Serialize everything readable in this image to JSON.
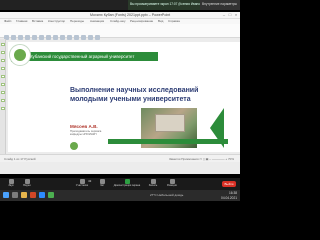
{
  "notifications": {
    "left_text": "",
    "mid_text": "Вы просматриваете экран 17:07 (Ксения Иванова)",
    "right_text": "Внутренние параметры"
  },
  "window": {
    "title": "Мохилх Кубан (Fonts) 2021ppt.pptx – PowerPoint",
    "menu": [
      "Файл",
      "Главная",
      "Вставка",
      "Конструктор",
      "Переходы",
      "Анимация",
      "Слайд-шоу",
      "Рецензирование",
      "Вид",
      "Справка"
    ],
    "minimize": "–",
    "maximize": "□",
    "close": "×"
  },
  "slide": {
    "banner_text": "Кубанский государственный аграрный университет",
    "title": "Выполнение научных исследований молодыми учеными университета",
    "author": "Мясоев А.В.",
    "author_sub": "Преподаватель сервиса\nкафедры НПОИНКП"
  },
  "status": {
    "left": "Слайд 1 из 17   Русский",
    "right": "Заметки   Примечания   ▭ ▯ ▣   − ────── +  70%"
  },
  "meeting": {
    "buttons": [
      "Звук",
      "Видео",
      "Участники",
      "Чат",
      "Демонстрация экрана",
      "Запись",
      "Реакции"
    ],
    "end_label": "Выйти",
    "participants_count": "43"
  },
  "taskbar": {
    "time": "16:38",
    "date": "04.04.2021",
    "tray": "27°C  Небольшой дождь"
  },
  "colors": {
    "accent_green": "#2c8c3a",
    "title_blue": "#2b3b73",
    "author_red": "#b0382e"
  }
}
